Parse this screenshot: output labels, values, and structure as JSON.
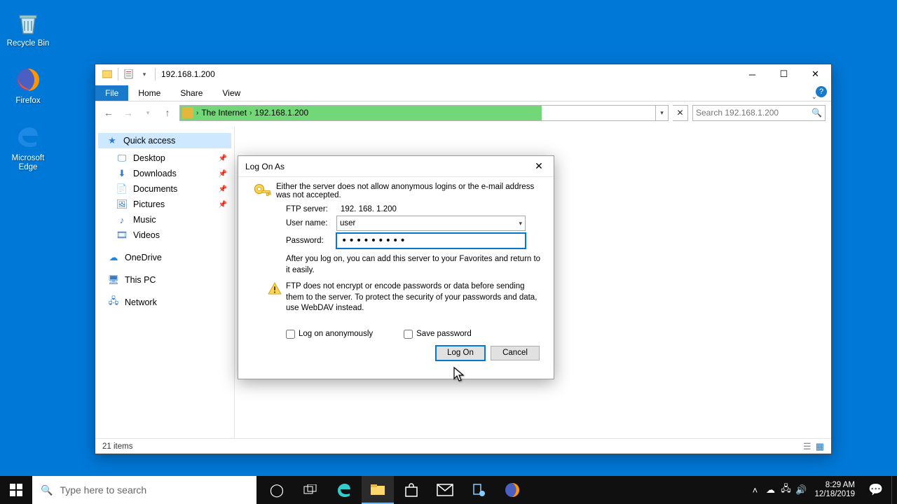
{
  "desktop": {
    "icons": [
      {
        "name": "recycle-bin-icon",
        "label": "Recycle Bin"
      },
      {
        "name": "firefox-icon",
        "label": "Firefox"
      },
      {
        "name": "edge-icon",
        "label": "Microsoft Edge"
      }
    ]
  },
  "explorer": {
    "title": "192.168.1.200",
    "tabs": {
      "file": "File",
      "home": "Home",
      "share": "Share",
      "view": "View"
    },
    "breadcrumb": {
      "root": "The Internet",
      "leaf": "192.168.1.200"
    },
    "search_placeholder": "Search 192.168.1.200",
    "sidebar": {
      "quick": "Quick access",
      "sub": [
        {
          "name": "sidebar-desktop",
          "label": "Desktop",
          "pinned": true,
          "icon": "desktop-icon"
        },
        {
          "name": "sidebar-downloads",
          "label": "Downloads",
          "pinned": true,
          "icon": "downloads-icon"
        },
        {
          "name": "sidebar-documents",
          "label": "Documents",
          "pinned": true,
          "icon": "documents-icon"
        },
        {
          "name": "sidebar-pictures",
          "label": "Pictures",
          "pinned": true,
          "icon": "pictures-icon"
        },
        {
          "name": "sidebar-music",
          "label": "Music",
          "pinned": false,
          "icon": "music-icon"
        },
        {
          "name": "sidebar-videos",
          "label": "Videos",
          "pinned": false,
          "icon": "videos-icon"
        }
      ],
      "onedrive": "OneDrive",
      "thispc": "This PC",
      "network": "Network"
    },
    "status": "21 items"
  },
  "dialog": {
    "title": "Log On As",
    "message": "Either the server does not allow anonymous logins or the e-mail address was not accepted.",
    "ftp_label": "FTP server:",
    "ftp_value": "192. 168. 1.200",
    "user_label": "User name:",
    "user_value": "user",
    "pwd_label": "Password:",
    "pwd_value": "•••••••••",
    "after_note": "After you log on, you can add this server to your Favorites and return to it easily.",
    "warning": "FTP does not encrypt or encode passwords or data before sending them to the server.  To protect the security of your passwords and data, use WebDAV instead.",
    "anon_label": "Log on anonymously",
    "save_label": "Save password",
    "logon_btn": "Log On",
    "cancel_btn": "Cancel"
  },
  "taskbar": {
    "search_placeholder": "Type here to search",
    "time": "8:29 AM",
    "date": "12/18/2019"
  }
}
